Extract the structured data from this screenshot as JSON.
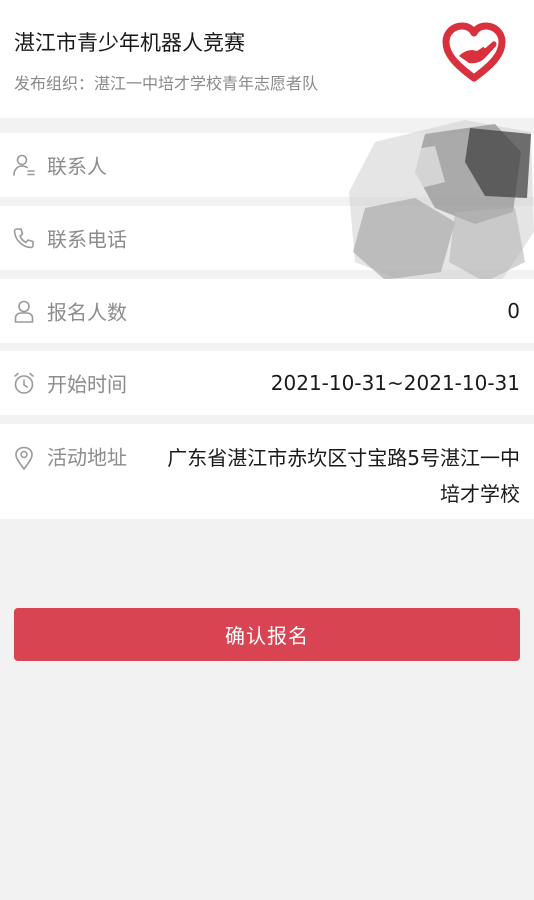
{
  "header": {
    "title": "湛江市青少年机器人竞赛",
    "publisher": "发布组织：湛江一中培才学校青年志愿者队",
    "logo_icon": "volunteer-heart-hand-icon",
    "logo_color": "#d8303c"
  },
  "form": {
    "contact": {
      "label": "联系人",
      "value": "",
      "icon": "user-icon"
    },
    "phone": {
      "label": "联系电话",
      "value": "",
      "icon": "phone-icon"
    },
    "signup_count": {
      "label": "报名人数",
      "value": "0",
      "icon": "person-icon"
    },
    "start_time": {
      "label": "开始时间",
      "value": "2021-10-31~2021-10-31",
      "icon": "alarm-clock-icon"
    },
    "address": {
      "label": "活动地址",
      "value": "广东省湛江市赤坎区寸宝路5号湛江一中培才学校",
      "icon": "location-pin-icon"
    }
  },
  "actions": {
    "confirm_label": "确认报名",
    "confirm_color": "#d84452"
  },
  "theme": {
    "background": "#f2f2f2",
    "label_color": "#8c8c8c",
    "icon_color": "#9a9a9a"
  }
}
